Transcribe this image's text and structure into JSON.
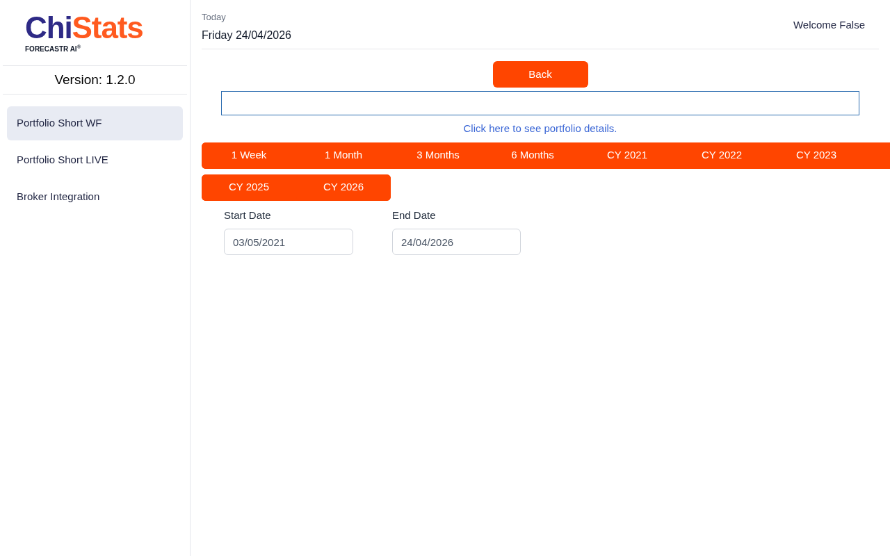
{
  "sidebar": {
    "logo": {
      "brand_left": "Chi",
      "brand_right": "Stats",
      "tagline": "FORECASTR AI",
      "tagline_mark": "®"
    },
    "version": "Version: 1.2.0",
    "items": [
      {
        "label": "Portfolio Short WF",
        "selected": true
      },
      {
        "label": "Portfolio Short LIVE",
        "selected": false
      },
      {
        "label": "Broker Integration",
        "selected": false
      }
    ]
  },
  "header": {
    "date_label": "Today",
    "date": "Friday 24/04/2026",
    "welcome": "Welcome False"
  },
  "back_button": "Back",
  "details_link": "Click here to see portfolio details.",
  "period_rows": [
    [
      "1 Week",
      "1 Month",
      "3 Months",
      "6 Months",
      "CY 2021",
      "CY 2022",
      "CY 2023"
    ],
    [
      "CY 2025",
      "CY 2026"
    ]
  ],
  "start_date": {
    "label": "Start Date",
    "value": "03/05/2021"
  },
  "end_date": {
    "label": "End Date",
    "value": "24/04/2026"
  }
}
